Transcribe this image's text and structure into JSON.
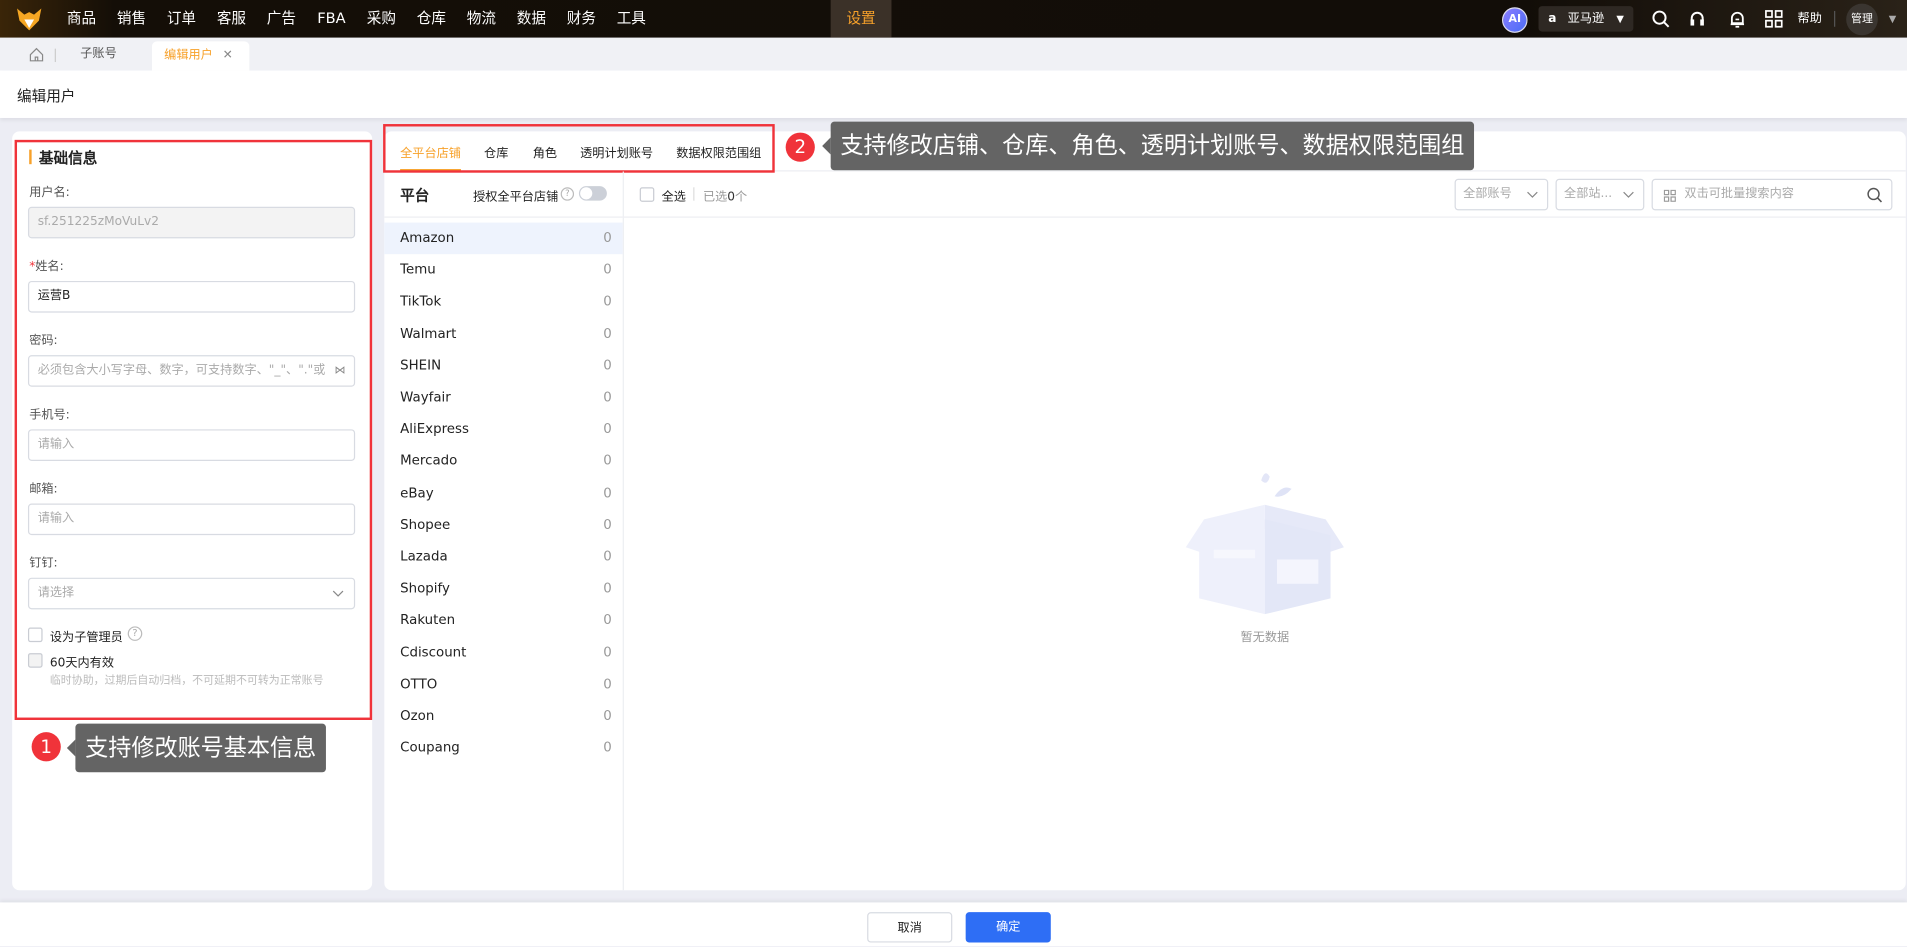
{
  "nav": {
    "items": [
      "商品",
      "销售",
      "订单",
      "客服",
      "广告",
      "FBA",
      "采购",
      "仓库",
      "物流",
      "数据",
      "财务",
      "工具",
      "设置"
    ],
    "active": "设置",
    "ai_label": "AI",
    "marketplace": "亚马逊",
    "help": "帮助",
    "user": "管理"
  },
  "tabs": {
    "items": [
      {
        "label": "子账号"
      },
      {
        "label": "编辑用户"
      }
    ]
  },
  "page_title": "编辑用户",
  "basic": {
    "title": "基础信息",
    "username_label": "用户名:",
    "username_value": "sf.251225zMoVuLv2",
    "name_label": "姓名:",
    "name_required": "*",
    "name_value": "运营B",
    "password_label": "密码:",
    "password_placeholder": "必须包含大小写字母、数字，可支持数字、\"_\"、\".\"或\"-\"",
    "phone_label": "手机号:",
    "phone_placeholder": "请输入",
    "email_label": "邮箱:",
    "email_placeholder": "请输入",
    "dingtalk_label": "钉钉:",
    "dingtalk_placeholder": "请选择",
    "sub_admin_label": "设为子管理员",
    "temp_label": "60天内有效",
    "temp_hint": "临时协助，过期后自动归档，不可延期不可转为正常账号"
  },
  "perm_tabs": [
    "全平台店铺",
    "仓库",
    "角色",
    "透明计划账号",
    "数据权限范围组"
  ],
  "platform_header": "平台",
  "authorize_all": "授权全平台店铺",
  "select_all": "全选",
  "selected_prefix": "已选",
  "selected_count": "0",
  "selected_suffix": "个",
  "filters": {
    "account": "全部账号",
    "site": "全部站...",
    "search_placeholder": "双击可批量搜索内容"
  },
  "platforms": [
    {
      "name": "Amazon",
      "count": "0"
    },
    {
      "name": "Temu",
      "count": "0"
    },
    {
      "name": "TikTok",
      "count": "0"
    },
    {
      "name": "Walmart",
      "count": "0"
    },
    {
      "name": "SHEIN",
      "count": "0"
    },
    {
      "name": "Wayfair",
      "count": "0"
    },
    {
      "name": "AliExpress",
      "count": "0"
    },
    {
      "name": "Mercado",
      "count": "0"
    },
    {
      "name": "eBay",
      "count": "0"
    },
    {
      "name": "Shopee",
      "count": "0"
    },
    {
      "name": "Lazada",
      "count": "0"
    },
    {
      "name": "Shopify",
      "count": "0"
    },
    {
      "name": "Rakuten",
      "count": "0"
    },
    {
      "name": "Cdiscount",
      "count": "0"
    },
    {
      "name": "OTTO",
      "count": "0"
    },
    {
      "name": "Ozon",
      "count": "0"
    },
    {
      "name": "Coupang",
      "count": "0"
    }
  ],
  "empty_text": "暂无数据",
  "callouts": [
    {
      "num": "1",
      "text": "支持修改账号基本信息"
    },
    {
      "num": "2",
      "text": "支持修改店铺、仓库、角色、透明计划账号、数据权限范围组"
    }
  ],
  "footer": {
    "cancel": "取消",
    "confirm": "确定"
  },
  "colors": {
    "accent": "#f7a12a",
    "primary": "#2e6ef5",
    "annotation": "#f0333a"
  }
}
